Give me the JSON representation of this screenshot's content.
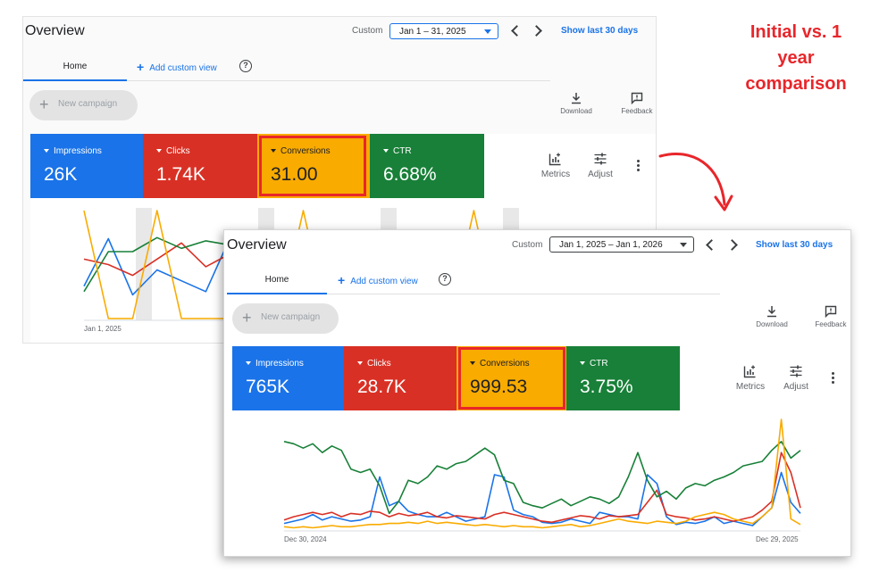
{
  "annotation": "Initial vs. 1 year comparison",
  "colors": {
    "impressions": "#1a73e8",
    "clicks": "#d93025",
    "conversions": "#f9ab00",
    "ctr": "#188038",
    "highlight": "#e8262b",
    "link": "#1a73e8"
  },
  "panel1": {
    "title": "Overview",
    "custom_label": "Custom",
    "date_range": "Jan 1 – 31, 2025",
    "show_last": "Show last 30 days",
    "tab_home": "Home",
    "add_custom_view": "Add custom view",
    "new_campaign": "New campaign",
    "download": "Download",
    "feedback": "Feedback",
    "metrics_label": "Metrics",
    "adjust_label": "Adjust",
    "cards": [
      {
        "label": "Impressions",
        "value": "26K"
      },
      {
        "label": "Clicks",
        "value": "1.74K"
      },
      {
        "label": "Conversions",
        "value": "31.00"
      },
      {
        "label": "CTR",
        "value": "6.68%"
      }
    ],
    "x_start": "Jan 1, 2025",
    "chart_data": {
      "type": "line",
      "x": [
        1,
        2,
        3,
        4,
        5,
        6,
        7,
        8,
        9,
        10,
        11,
        12,
        13,
        14,
        15,
        16,
        17,
        18,
        19,
        20,
        21,
        22,
        23
      ],
      "series": [
        {
          "values": [
            0.3,
            0.74,
            0.22,
            0.45,
            0.35,
            0.25,
            0.75,
            0.28,
            0.4,
            0.25,
            0.5,
            0.2,
            0.7,
            0.45,
            0.3,
            0.65,
            0.4,
            0.28,
            0.55,
            0.35,
            0.6,
            0.4,
            0.55
          ]
        },
        {
          "values": [
            0.55,
            0.5,
            0.4,
            0.55,
            0.7,
            0.48,
            0.6,
            0.4,
            0.55,
            0.35,
            0.65,
            0.45,
            0.6,
            0.4,
            0.55,
            0.38,
            0.5,
            0.62,
            0.45,
            0.58,
            0.4,
            0.6,
            0.5
          ]
        },
        {
          "values": [
            0.25,
            0.62,
            0.62,
            0.75,
            0.65,
            0.72,
            0.68,
            0.78,
            0.6,
            0.55,
            0.7,
            0.55,
            0.75,
            0.6,
            0.7,
            0.58,
            0.72,
            0.62,
            0.75,
            0.65,
            0.7,
            0.6,
            0.72
          ]
        },
        {
          "values": [
            1.0,
            0.0,
            0.0,
            1.0,
            0.0,
            0.0,
            0.0,
            0.0,
            0.0,
            1.0,
            0.0,
            0.0,
            0.55,
            0.0,
            0.0,
            0.0,
            1.0,
            0.0,
            0.0,
            0.0,
            0.5,
            0.0,
            0.0
          ]
        }
      ]
    }
  },
  "panel2": {
    "title": "Overview",
    "custom_label": "Custom",
    "date_range": "Jan 1, 2025 – Jan 1, 2026",
    "show_last": "Show last 30 days",
    "tab_home": "Home",
    "add_custom_view": "Add custom view",
    "new_campaign": "New campaign",
    "download": "Download",
    "feedback": "Feedback",
    "metrics_label": "Metrics",
    "adjust_label": "Adjust",
    "cards": [
      {
        "label": "Impressions",
        "value": "765K"
      },
      {
        "label": "Clicks",
        "value": "28.7K"
      },
      {
        "label": "Conversions",
        "value": "999.53"
      },
      {
        "label": "CTR",
        "value": "3.75%"
      }
    ],
    "x_start": "Dec 30, 2024",
    "x_end": "Dec 29, 2025",
    "chart_data": {
      "type": "line",
      "x_start": "Dec 30, 2024",
      "x_end": "Dec 29, 2025",
      "series": [
        {
          "values": [
            0.06,
            0.08,
            0.1,
            0.14,
            0.09,
            0.12,
            0.1,
            0.08,
            0.09,
            0.12,
            0.48,
            0.22,
            0.26,
            0.17,
            0.14,
            0.12,
            0.12,
            0.16,
            0.12,
            0.08,
            0.1,
            0.12,
            0.5,
            0.48,
            0.18,
            0.14,
            0.12,
            0.07,
            0.06,
            0.07,
            0.1,
            0.08,
            0.06,
            0.16,
            0.14,
            0.12,
            0.12,
            0.1,
            0.5,
            0.42,
            0.12,
            0.05,
            0.07,
            0.06,
            0.08,
            0.12,
            0.06,
            0.08,
            0.06,
            0.04,
            0.12,
            0.2,
            0.52,
            0.25,
            0.15
          ]
        },
        {
          "values": [
            0.09,
            0.12,
            0.14,
            0.16,
            0.14,
            0.16,
            0.12,
            0.15,
            0.14,
            0.17,
            0.16,
            0.12,
            0.15,
            0.13,
            0.14,
            0.16,
            0.12,
            0.11,
            0.13,
            0.12,
            0.11,
            0.1,
            0.14,
            0.16,
            0.14,
            0.12,
            0.1,
            0.08,
            0.07,
            0.09,
            0.11,
            0.13,
            0.12,
            0.1,
            0.13,
            0.12,
            0.13,
            0.14,
            0.25,
            0.36,
            0.14,
            0.12,
            0.11,
            0.09,
            0.1,
            0.12,
            0.1,
            0.08,
            0.1,
            0.12,
            0.18,
            0.26,
            0.7,
            0.52,
            0.2
          ]
        },
        {
          "values": [
            0.8,
            0.78,
            0.74,
            0.78,
            0.7,
            0.76,
            0.72,
            0.55,
            0.52,
            0.55,
            0.4,
            0.15,
            0.26,
            0.45,
            0.42,
            0.48,
            0.58,
            0.55,
            0.6,
            0.62,
            0.68,
            0.74,
            0.68,
            0.45,
            0.42,
            0.25,
            0.22,
            0.2,
            0.24,
            0.28,
            0.22,
            0.26,
            0.3,
            0.28,
            0.24,
            0.3,
            0.48,
            0.7,
            0.45,
            0.3,
            0.35,
            0.28,
            0.38,
            0.42,
            0.4,
            0.45,
            0.48,
            0.52,
            0.58,
            0.6,
            0.62,
            0.72,
            0.8,
            0.65,
            0.72
          ]
        },
        {
          "values": [
            0.03,
            0.02,
            0.03,
            0.02,
            0.03,
            0.04,
            0.03,
            0.03,
            0.04,
            0.05,
            0.05,
            0.06,
            0.06,
            0.07,
            0.06,
            0.08,
            0.06,
            0.07,
            0.06,
            0.05,
            0.04,
            0.05,
            0.04,
            0.03,
            0.04,
            0.03,
            0.03,
            0.02,
            0.03,
            0.04,
            0.05,
            0.03,
            0.04,
            0.06,
            0.08,
            0.1,
            0.08,
            0.07,
            0.06,
            0.08,
            0.07,
            0.06,
            0.08,
            0.12,
            0.14,
            0.16,
            0.14,
            0.1,
            0.08,
            0.06,
            0.12,
            0.2,
            1.0,
            0.1,
            0.05
          ]
        }
      ]
    }
  }
}
